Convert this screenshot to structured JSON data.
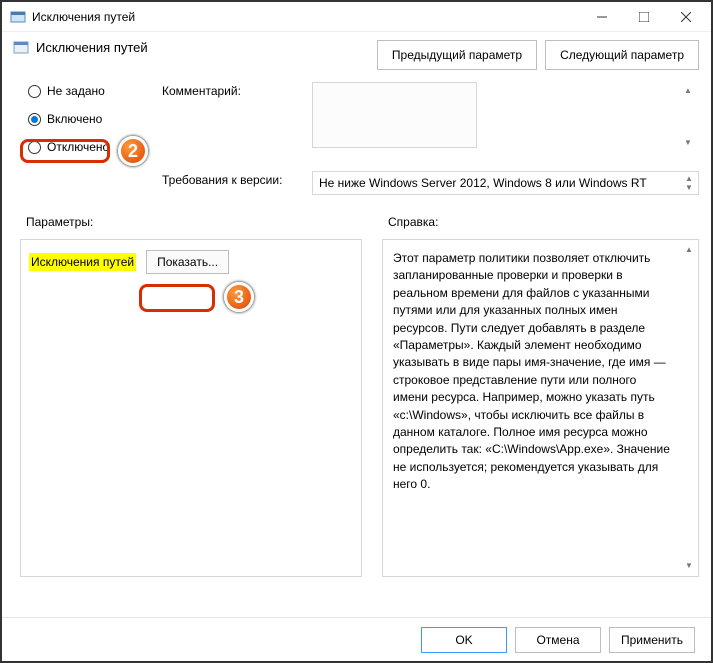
{
  "window": {
    "title": "Исключения путей"
  },
  "header": {
    "title": "Исключения путей",
    "prev": "Предыдущий параметр",
    "next": "Следующий параметр"
  },
  "radios": {
    "not_configured": "Не задано",
    "enabled": "Включено",
    "disabled": "Отключено"
  },
  "fields": {
    "comment": "Комментарий:",
    "requirements": "Требования к версии:",
    "req_value": "Не ниже Windows Server 2012, Windows 8 или Windows RT"
  },
  "sections": {
    "params": "Параметры:",
    "help": "Справка:"
  },
  "params": {
    "item_name": "Исключения путей",
    "show": "Показать..."
  },
  "help": {
    "text": "Этот параметр политики позволяет отключить запланированные проверки и проверки в реальном времени для файлов с указанными путями или для указанных полных имен ресурсов. Пути следует добавлять в разделе «Параметры». Каждый элемент необходимо указывать в виде пары имя-значение, где имя — строковое представление пути или полного имени ресурса. Например, можно указать путь «c:\\Windows», чтобы исключить все файлы в данном каталоге. Полное имя ресурса можно определить так: «C:\\Windows\\App.exe». Значение не используется; рекомендуется указывать для него 0."
  },
  "footer": {
    "ok": "OK",
    "cancel": "Отмена",
    "apply": "Применить"
  },
  "callouts": {
    "c2": "2",
    "c3": "3"
  }
}
